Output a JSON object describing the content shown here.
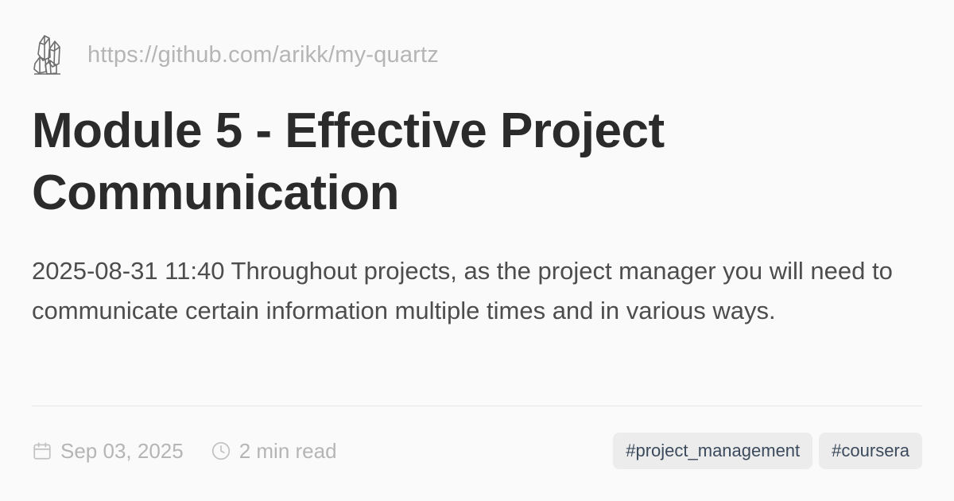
{
  "header": {
    "logo_icon": "quartz-crystal-icon",
    "site_url": "https://github.com/arikk/my-quartz"
  },
  "article": {
    "title": "Module 5 - Effective Project Communication",
    "description": "2025-08-31 11:40 Throughout projects, as the project manager you will need to communicate certain information multiple times and in various ways."
  },
  "footer": {
    "date_icon": "calendar-icon",
    "date": "Sep 03, 2025",
    "read_icon": "clock-icon",
    "read_time": "2 min read",
    "tags": [
      "#project_management",
      "#coursera"
    ]
  },
  "colors": {
    "background": "#fafafa",
    "title": "#2b2b2b",
    "muted": "#b5b5b5",
    "tag_bg": "#ececec",
    "tag_text": "#3b4a5c"
  }
}
